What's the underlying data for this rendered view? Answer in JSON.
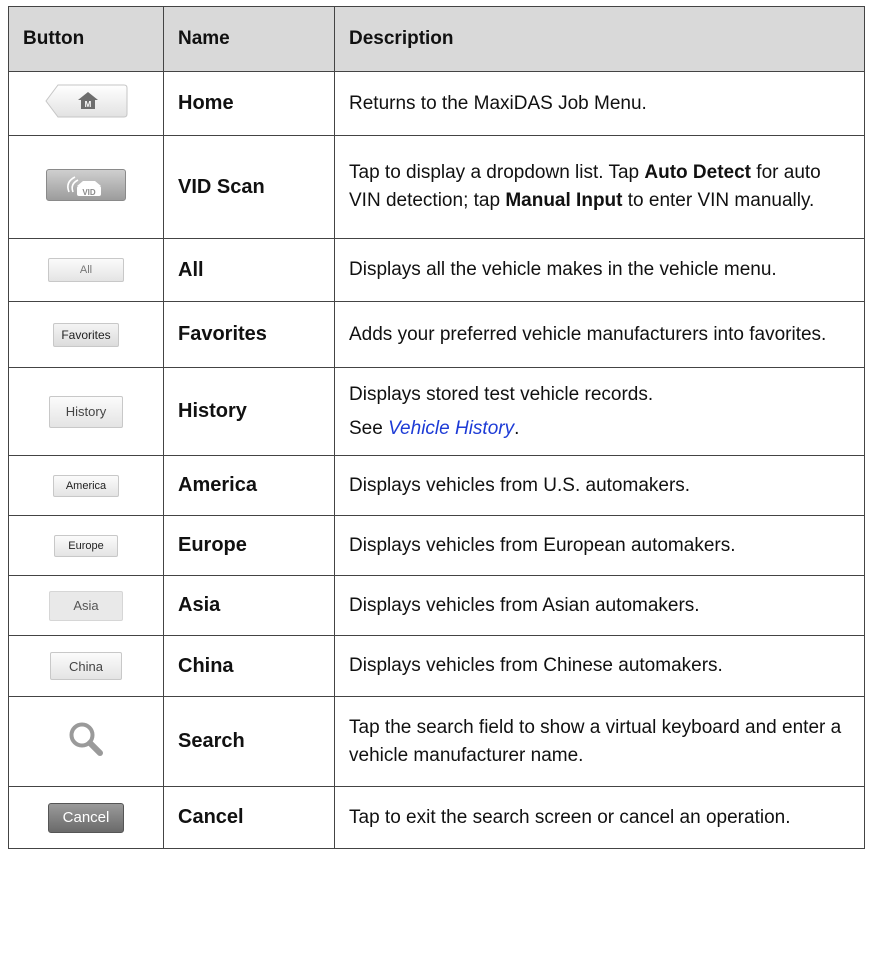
{
  "table": {
    "headers": {
      "button": "Button",
      "name": "Name",
      "description": "Description"
    },
    "rows": [
      {
        "thumb": "",
        "name": "Home",
        "desc": [
          {
            "t": "Returns to the MaxiDAS Job Menu."
          }
        ]
      },
      {
        "thumb": "",
        "name": "VID Scan",
        "desc": [
          {
            "t": "Tap to display a dropdown list. Tap "
          },
          {
            "t": "Auto Detect",
            "b": true
          },
          {
            "t": " for auto VIN detection; tap "
          },
          {
            "t": "Manual Input",
            "b": true
          },
          {
            "t": " to enter VIN manually."
          }
        ]
      },
      {
        "thumb": "All",
        "name": "All",
        "desc": [
          {
            "t": "Displays all the vehicle makes in the vehicle menu."
          }
        ]
      },
      {
        "thumb": "Favorites",
        "name": "Favorites",
        "desc": [
          {
            "t": "Adds your preferred vehicle manufacturers into favorites."
          }
        ]
      },
      {
        "thumb": "History",
        "name": "History",
        "desc": [
          {
            "t": "Displays stored test vehicle records."
          }
        ],
        "desc2": [
          {
            "t": "See "
          },
          {
            "t": "Vehicle History",
            "link": true
          },
          {
            "t": "."
          }
        ]
      },
      {
        "thumb": "America",
        "name": "America",
        "desc": [
          {
            "t": "Displays vehicles from U.S. automakers."
          }
        ]
      },
      {
        "thumb": "Europe",
        "name": "Europe",
        "desc": [
          {
            "t": "Displays vehicles from European automakers."
          }
        ]
      },
      {
        "thumb": "Asia",
        "name": "Asia",
        "desc": [
          {
            "t": "Displays vehicles from Asian automakers."
          }
        ]
      },
      {
        "thumb": "China",
        "name": "China",
        "desc": [
          {
            "t": "Displays vehicles from Chinese automakers."
          }
        ]
      },
      {
        "thumb": "",
        "name": "Search",
        "desc": [
          {
            "t": "Tap the search field to show a virtual keyboard and enter a vehicle manufacturer name."
          }
        ]
      },
      {
        "thumb": "Cancel",
        "name": "Cancel",
        "desc": [
          {
            "t": "Tap to exit the search screen or cancel an operation."
          }
        ]
      }
    ],
    "icons": [
      "home-icon",
      "vid-scan-icon",
      "search-icon"
    ]
  }
}
